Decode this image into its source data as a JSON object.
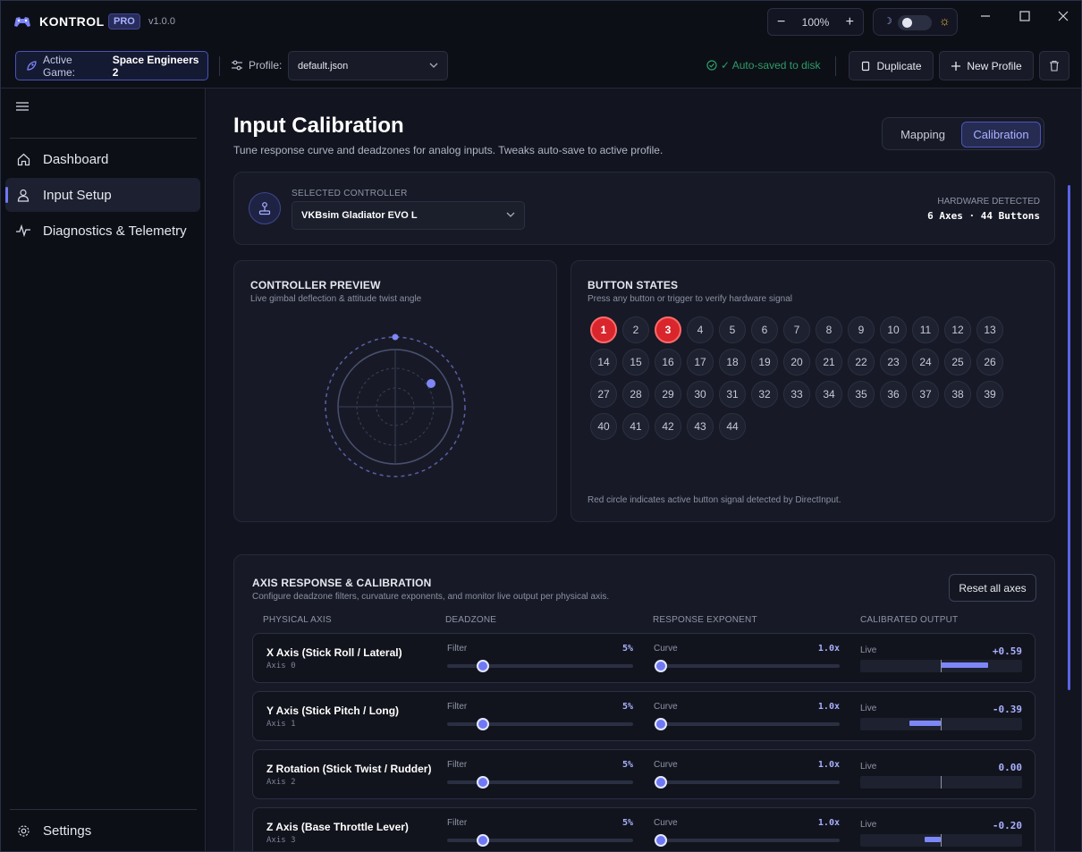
{
  "app": {
    "name": "KONTROL",
    "badge": "PRO",
    "version": "v1.0.0"
  },
  "zoom": {
    "level": "100%",
    "minus": "−",
    "plus": "+"
  },
  "theme": {
    "moon": "☽",
    "sun": "☼"
  },
  "window": {
    "minimize": "—",
    "maximize": "☐",
    "close": "✕"
  },
  "toolbar": {
    "game_label": "Active Game:",
    "game_value": "Space Engineers 2",
    "profile_label": "Profile:",
    "profile_value": "default.json",
    "autosave": "✓ Auto-saved to disk",
    "duplicate": "Duplicate",
    "new_profile": "New Profile"
  },
  "sidebar": {
    "items": [
      {
        "label": "Dashboard",
        "icon": "home-icon"
      },
      {
        "label": "Input Setup",
        "icon": "user-icon"
      },
      {
        "label": "Diagnostics & Telemetry",
        "icon": "pulse-icon"
      }
    ],
    "settings": "Settings"
  },
  "page": {
    "title": "Input Calibration",
    "subtitle": "Tune response curve and deadzones for analog inputs. Tweaks auto-save to active profile.",
    "tabs": [
      "Mapping",
      "Calibration"
    ],
    "active_tab": "Calibration"
  },
  "controller": {
    "caption": "SELECTED CONTROLLER",
    "name": "VKBsim Gladiator EVO L",
    "hw_caption": "HARDWARE DETECTED",
    "hw_value": "6 Axes · 44 Buttons"
  },
  "preview": {
    "title": "CONTROLLER PREVIEW",
    "subtitle": "Live gimbal deflection & attitude twist angle"
  },
  "buttons": {
    "title": "BUTTON STATES",
    "subtitle": "Press any button or trigger to verify hardware signal",
    "count": 44,
    "active": [
      1,
      3
    ],
    "note": "Red circle indicates active button signal detected by DirectInput."
  },
  "axes": {
    "title": "AXIS RESPONSE & CALIBRATION",
    "subtitle": "Configure deadzone filters, curvature exponents, and monitor live output per physical axis.",
    "reset": "Reset all axes",
    "headers": [
      "PHYSICAL AXIS",
      "DEADZONE",
      "RESPONSE EXPONENT",
      "CALIBRATED OUTPUT"
    ],
    "filter_label": "Filter",
    "curve_label": "Curve",
    "live_label": "Live",
    "rows": [
      {
        "name": "X Axis (Stick Roll / Lateral)",
        "index": "Axis 0",
        "deadzone": "5%",
        "curve": "1.0x",
        "output": "+0.59",
        "output_value": 0.59
      },
      {
        "name": "Y Axis (Stick Pitch / Long)",
        "index": "Axis 1",
        "deadzone": "5%",
        "curve": "1.0x",
        "output": "-0.39",
        "output_value": -0.39
      },
      {
        "name": "Z Rotation (Stick Twist / Rudder)",
        "index": "Axis 2",
        "deadzone": "5%",
        "curve": "1.0x",
        "output": "0.00",
        "output_value": 0.0
      },
      {
        "name": "Z Axis (Base Throttle Lever)",
        "index": "Axis 3",
        "deadzone": "5%",
        "curve": "1.0x",
        "output": "-0.20",
        "output_value": -0.2
      }
    ]
  },
  "colors": {
    "accent": "#6f79f5",
    "active_button": "#d9262c",
    "success": "#2e9c68"
  }
}
